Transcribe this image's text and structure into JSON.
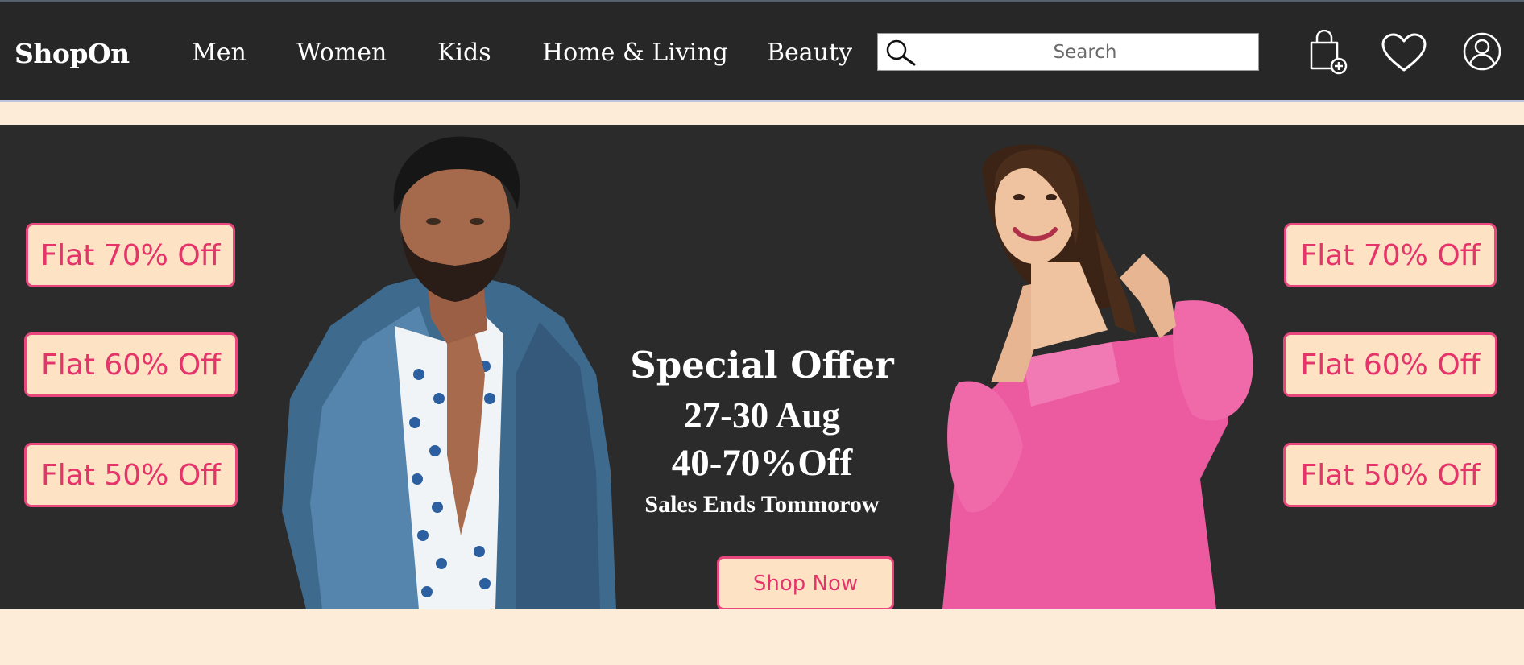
{
  "header": {
    "brand": "ShopOn",
    "nav": [
      {
        "label": "Men"
      },
      {
        "label": "Women"
      },
      {
        "label": "Kids"
      },
      {
        "label": "Home & Living"
      },
      {
        "label": "Beauty"
      }
    ],
    "search": {
      "placeholder": "Search",
      "value": ""
    },
    "icons": [
      "shopping-bag-icon",
      "heart-icon",
      "user-icon"
    ]
  },
  "banner": {
    "left_offers": [
      "Flat 70% Off",
      "Flat 60% Off",
      "Flat 50% Off"
    ],
    "right_offers": [
      "Flat 70% Off",
      "Flat 60% Off",
      "Flat 50% Off"
    ],
    "headline": "Special Offer",
    "dates": "27-30 Aug",
    "discount": "40-70%Off",
    "note": "Sales Ends Tommorow",
    "cta": "Shop Now"
  },
  "colors": {
    "nav_bg": "#272727",
    "banner_bg": "#2b2b2b",
    "page_bg": "#fdecd8",
    "accent": "#e8467c",
    "button_fill": "#fde3c4"
  }
}
